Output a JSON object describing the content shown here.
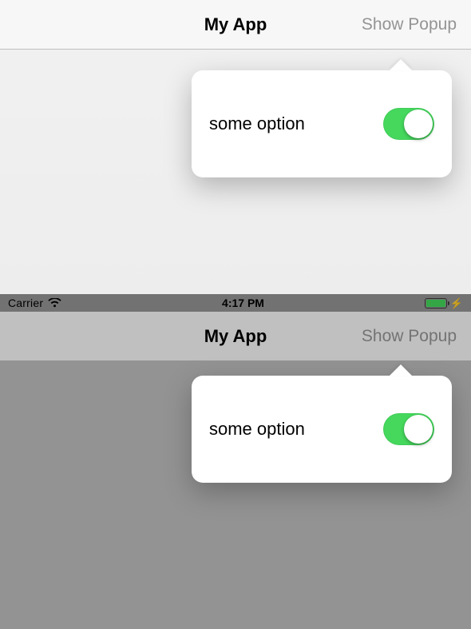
{
  "top": {
    "navbar": {
      "title": "My App",
      "right_button": "Show Popup"
    },
    "popover": {
      "option_label": "some option",
      "switch_on": true
    }
  },
  "bottom": {
    "statusbar": {
      "carrier": "Carrier",
      "time": "4:17 PM"
    },
    "navbar": {
      "title": "My App",
      "right_button": "Show Popup"
    },
    "popover": {
      "option_label": "some option",
      "switch_on": true
    }
  },
  "colors": {
    "switch_on": "#45d85d",
    "nav_title": "#000000",
    "nav_right_disabled": "#949494"
  }
}
